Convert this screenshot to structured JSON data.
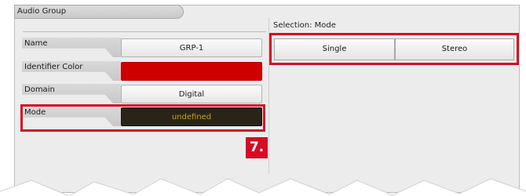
{
  "panel": {
    "title": "Audio Group"
  },
  "properties": [
    {
      "label": "Name",
      "value": "GRP-1"
    },
    {
      "label": "Identifier Color",
      "value": ""
    },
    {
      "label": "Domain",
      "value": "Digital"
    },
    {
      "label": "Mode",
      "value": "undefined"
    }
  ],
  "selection": {
    "label": "Selection: Mode",
    "options": [
      "Single",
      "Stereo"
    ]
  },
  "annotation": {
    "step": "7."
  },
  "colors": {
    "identifier": "#d10000",
    "highlight": "#d40c25",
    "mode_text": "#c7a01b",
    "mode_bg": "#2a2418"
  }
}
